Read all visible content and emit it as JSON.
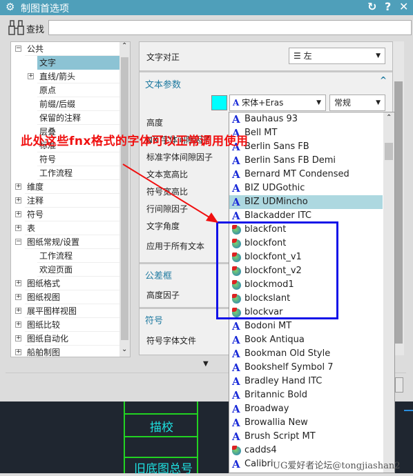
{
  "window": {
    "title": "制图首选项",
    "buttons": {
      "reset": "↻",
      "help": "?",
      "close": "✕"
    }
  },
  "search": {
    "label": "查找",
    "value": ""
  },
  "tree": {
    "items": [
      {
        "label": "公共",
        "level": 0,
        "toggle": "−"
      },
      {
        "label": "文字",
        "level": 1,
        "selected": true
      },
      {
        "label": "直线/箭头",
        "level": 1,
        "toggle": "+"
      },
      {
        "label": "原点",
        "level": 1
      },
      {
        "label": "前缀/后缀",
        "level": 1
      },
      {
        "label": "保留的注释",
        "level": 1
      },
      {
        "label": "层叠",
        "level": 1
      },
      {
        "label": "标准",
        "level": 1
      },
      {
        "label": "符号",
        "level": 1
      },
      {
        "label": "工作流程",
        "level": 1
      },
      {
        "label": "维度",
        "level": 0,
        "toggle": "+"
      },
      {
        "label": "注释",
        "level": 0,
        "toggle": "+"
      },
      {
        "label": "符号",
        "level": 0,
        "toggle": "+"
      },
      {
        "label": "表",
        "level": 0,
        "toggle": "+"
      },
      {
        "label": "图纸常规/设置",
        "level": 0,
        "toggle": "−"
      },
      {
        "label": "工作流程",
        "level": 1
      },
      {
        "label": "欢迎页面",
        "level": 1
      },
      {
        "label": "图纸格式",
        "level": 0,
        "toggle": "+"
      },
      {
        "label": "图纸视图",
        "level": 0,
        "toggle": "+"
      },
      {
        "label": "展平图样视图",
        "level": 0,
        "toggle": "+"
      },
      {
        "label": "图纸比较",
        "level": 0,
        "toggle": "+"
      },
      {
        "label": "图纸自动化",
        "level": 0,
        "toggle": "+"
      },
      {
        "label": "船舶制图",
        "level": 0,
        "toggle": "+"
      }
    ]
  },
  "panel": {
    "justify_label": "文字对正",
    "justify_value": "左",
    "text_params_header": "文本参数",
    "text_color": "#00ffff",
    "font_value": "宋体+Eras",
    "style_value": "常规",
    "labels": [
      "高度",
      "NX 字体间隙因子",
      "标准字体间隙因子",
      "文本宽高比",
      "符号宽高比",
      "行间隙因子",
      "文字角度",
      "应用于所有文本"
    ],
    "tolerance_header": "公差框",
    "height_factor": "高度因子",
    "symbol_header": "符号",
    "symbol_font_file": "符号字体文件"
  },
  "font_list": [
    {
      "name": "Bauhaus 93",
      "type": "truetype"
    },
    {
      "name": "Bell MT",
      "type": "truetype"
    },
    {
      "name": "Berlin Sans FB",
      "type": "truetype"
    },
    {
      "name": "Berlin Sans FB Demi",
      "type": "truetype"
    },
    {
      "name": "Bernard MT Condensed",
      "type": "truetype"
    },
    {
      "name": "BIZ UDGothic",
      "type": "truetype"
    },
    {
      "name": "BIZ UDMincho",
      "type": "truetype",
      "selected": true
    },
    {
      "name": "Blackadder ITC",
      "type": "truetype"
    },
    {
      "name": "blackfont",
      "type": "nx"
    },
    {
      "name": "blockfont",
      "type": "nx"
    },
    {
      "name": "blockfont_v1",
      "type": "nx"
    },
    {
      "name": "blockfont_v2",
      "type": "nx"
    },
    {
      "name": "blockmod1",
      "type": "nx"
    },
    {
      "name": "blockslant",
      "type": "nx"
    },
    {
      "name": "blockvar",
      "type": "nx"
    },
    {
      "name": "Bodoni MT",
      "type": "truetype"
    },
    {
      "name": "Book Antiqua",
      "type": "truetype"
    },
    {
      "name": "Bookman Old Style",
      "type": "truetype"
    },
    {
      "name": "Bookshelf Symbol 7",
      "type": "truetype"
    },
    {
      "name": "Bradley Hand ITC",
      "type": "truetype"
    },
    {
      "name": "Britannic Bold",
      "type": "truetype"
    },
    {
      "name": "Broadway",
      "type": "truetype"
    },
    {
      "name": "Browallia New",
      "type": "truetype"
    },
    {
      "name": "Brush Script MT",
      "type": "truetype"
    },
    {
      "name": "cadds4",
      "type": "nx"
    },
    {
      "name": "Calibri",
      "type": "truetype"
    }
  ],
  "annotation": {
    "text": "此处这些fnx格式的字体可以正常调用使用",
    "color": "#f01010",
    "box_color": "#1010e8"
  },
  "canvas": {
    "cells": [
      "描校",
      "旧底图总号"
    ]
  },
  "watermark": "UG爱好者论坛@tongjiashan2"
}
